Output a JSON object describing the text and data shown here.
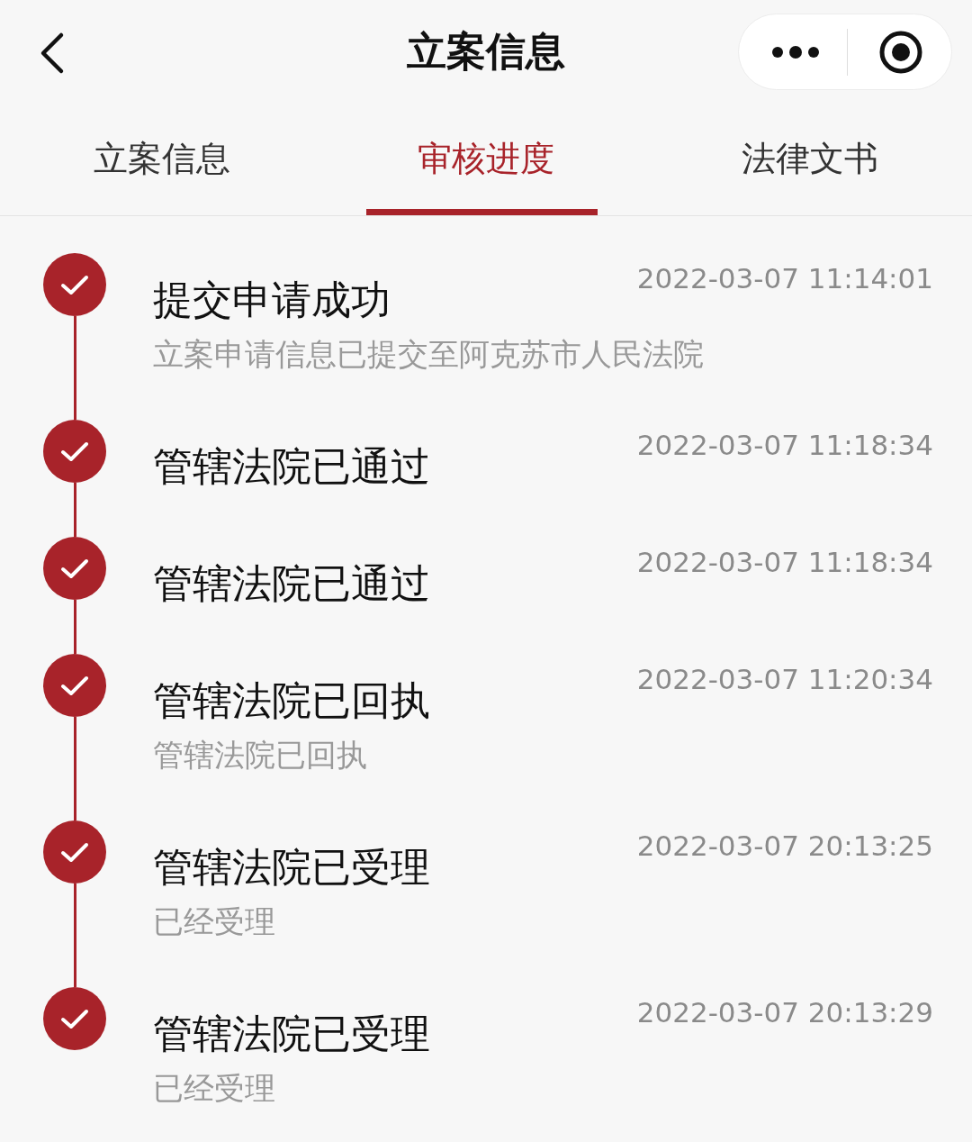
{
  "nav_bar": {
    "title": "立案信息"
  },
  "tabs": [
    {
      "label": "立案信息",
      "selected": false
    },
    {
      "label": "审核进度",
      "selected": true
    },
    {
      "label": "法律文书",
      "selected": false
    }
  ],
  "steps": [
    {
      "title": "提交申请成功",
      "time": "2022-03-07 11:14:01",
      "detail": "立案申请信息已提交至阿克苏市人民法院"
    },
    {
      "title": "管辖法院已通过",
      "time": "2022-03-07 11:18:34"
    },
    {
      "title": "管辖法院已通过",
      "time": "2022-03-07 11:18:34"
    },
    {
      "title": "管辖法院已回执",
      "time": "2022-03-07 11:20:34",
      "detail": "管辖法院已回执"
    },
    {
      "title": "管辖法院已受理",
      "time": "2022-03-07 20:13:25",
      "detail": "已经受理"
    },
    {
      "title": "管辖法院已受理",
      "time": "2022-03-07 20:13:29",
      "detail": "已经受理"
    }
  ]
}
